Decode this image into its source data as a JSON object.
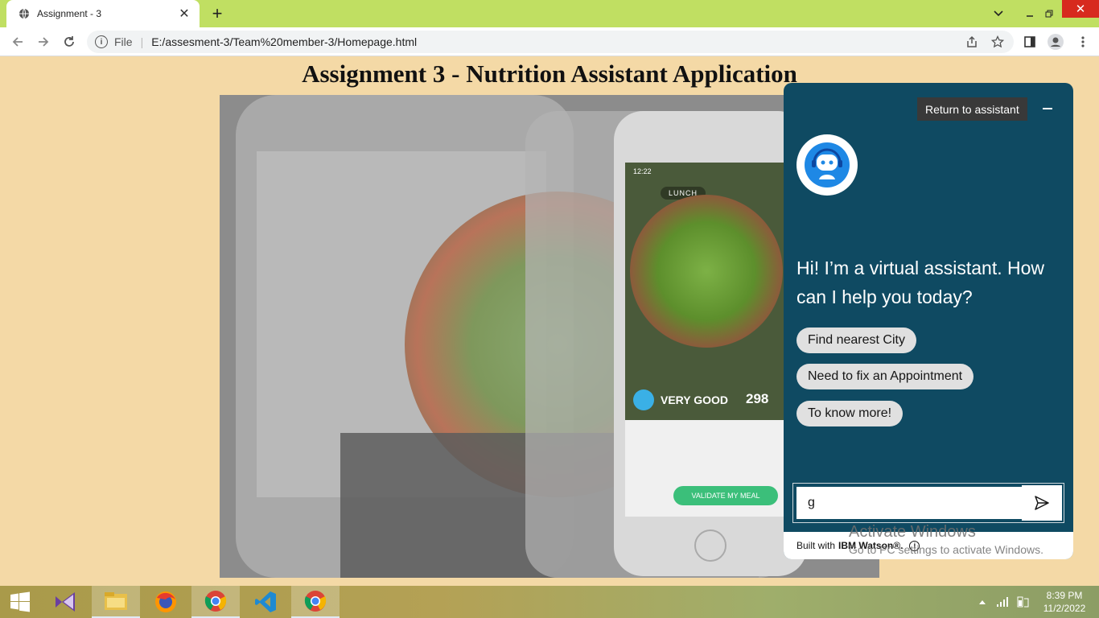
{
  "browser": {
    "tab_title": "Assignment - 3",
    "address_scheme": "File",
    "address_url": "E:/assesment-3/Team%20member-3/Homepage.html"
  },
  "page": {
    "title": "Assignment 3 - Nutrition Assistant Application"
  },
  "hero_image": {
    "status_time": "12:22",
    "meal_label": "LUNCH",
    "rating": "VERY GOOD",
    "kcal": "298",
    "validate_label": "VALIDATE MY MEAL"
  },
  "assistant": {
    "return_label": "Return to assistant",
    "greeting": "Hi! I’m a virtual assistant. How can I help you today?",
    "options": [
      {
        "label": "Find nearest City"
      },
      {
        "label": "Need to fix an Appointment"
      },
      {
        "label": "To know more!"
      }
    ],
    "input_value": "g",
    "footer_prefix": "Built with",
    "footer_brand": "IBM Watson®."
  },
  "watermark": {
    "line1": "Activate Windows",
    "line2": "Go to PC settings to activate Windows."
  },
  "taskbar": {
    "time": "8:39 PM",
    "date": "11/2/2022"
  },
  "colors": {
    "page_bg": "#f4d9a6",
    "tabbar_bg": "#c0df62",
    "assistant_bg": "#0f4a62",
    "assistant_avatar_accent": "#1e88e5",
    "close_button": "#d72a1e"
  }
}
